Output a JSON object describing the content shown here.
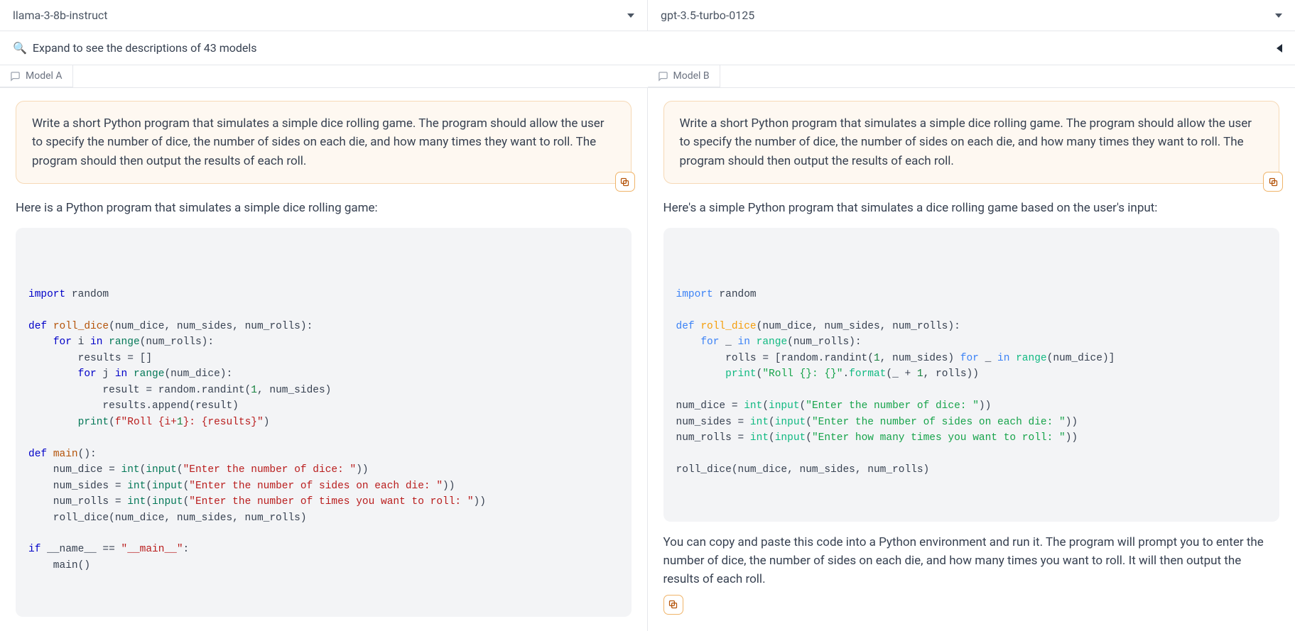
{
  "selectors": {
    "left": "llama-3-8b-instruct",
    "right": "gpt-3.5-turbo-0125"
  },
  "expand": {
    "text": "Expand to see the descriptions of 43 models"
  },
  "tabs": {
    "left": "Model A",
    "right": "Model B"
  },
  "prompt": "Write a short Python program that simulates a simple dice rolling game. The program should allow the user to specify the number of dice, the number of sides on each die, and how many times they want to roll. The program should then output the results of each roll.",
  "modelA": {
    "intro": "Here is a Python program that simulates a simple dice rolling game:",
    "code_plain": "import random\n\ndef roll_dice(num_dice, num_sides, num_rolls):\n    for i in range(num_rolls):\n        results = []\n        for j in range(num_dice):\n            result = random.randint(1, num_sides)\n            results.append(result)\n        print(f\"Roll {i+1}: {results}\")\n\ndef main():\n    num_dice = int(input(\"Enter the number of dice: \"))\n    num_sides = int(input(\"Enter the number of sides on each die: \"))\n    num_rolls = int(input(\"Enter the number of times you want to roll: \"))\n    roll_dice(num_dice, num_sides, num_rolls)\n\nif __name__ == \"__main__\":\n    main()"
  },
  "modelB": {
    "intro": "Here's a simple Python program that simulates a dice rolling game based on the user's input:",
    "code_plain": "import random\n\ndef roll_dice(num_dice, num_sides, num_rolls):\n    for _ in range(num_rolls):\n        rolls = [random.randint(1, num_sides) for _ in range(num_dice)]\n        print(\"Roll {}: {}\".format(_ + 1, rolls))\n\nnum_dice = int(input(\"Enter the number of dice: \"))\nnum_sides = int(input(\"Enter the number of sides on each die: \"))\nnum_rolls = int(input(\"Enter how many times you want to roll: \"))\n\nroll_dice(num_dice, num_sides, num_rolls)",
    "outro": "You can copy and paste this code into a Python environment and run it. The program will prompt you to enter the number of dice, the number of sides on each die, and how many times you want to roll. It will then output the results of each roll."
  }
}
